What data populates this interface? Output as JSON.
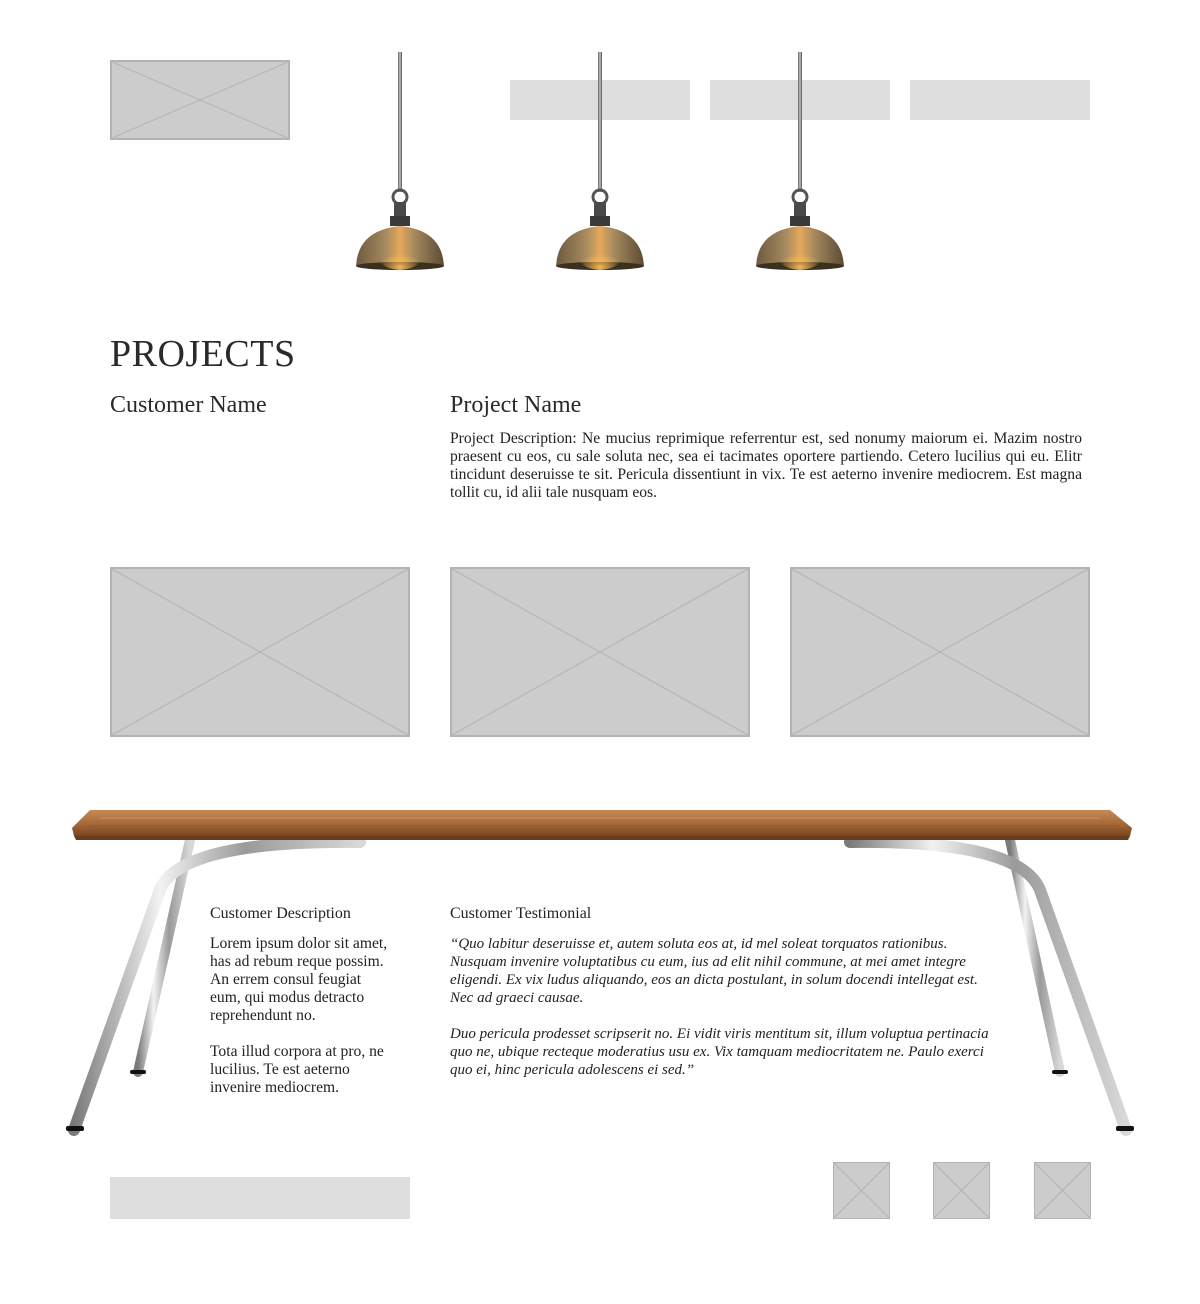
{
  "header": {
    "logo_placeholder": "logo-image-placeholder",
    "nav_items": [
      "",
      "",
      ""
    ]
  },
  "projects": {
    "heading": "PROJECTS",
    "customer_name": "Customer Name",
    "project_name": "Project Name",
    "project_description": "Project Description: Ne mucius reprimique referrentur est, sed nonumy maiorum ei. Mazim nostro praesent cu eos, cu sale soluta nec, sea ei tacimates oportere partiendo. Cetero lucilius qui eu. Elitr tincidunt deseruisse te sit. Pericula dissentiunt in vix. Te est aeterno invenire me­diocrem. Est magna tollit cu, id alii tale nusquam eos."
  },
  "customer": {
    "description_title": "Customer Description",
    "description_paragraphs": [
      "Lorem ipsum dolor sit amet, has ad rebum reque possim. An errem consul feugiat eum, qui modus detracto reprehendunt no.",
      "Tota illud corpora at pro, ne lucilius. Te est aeterno invenire mediocrem."
    ],
    "testimonial_title": "Customer Testimonial",
    "testimonial_paragraphs": [
      "“Quo labitur deseruisse et, autem soluta eos at, id mel soleat torquatos rationibus. Nusquam invenire voluptatibus cu eum, ius ad elit nihil commune, at mei amet integre eligendi. Ex vix ludus aliquando, eos an dicta postulant, in solum docendi intellegat est. Nec ad graeci causae.",
      "Duo pericula prodesset scripserit no. Ei vidit viris mentitum sit, illum voluptua pertinacia quo ne, ubique recteque moderatius usu ex. Vix tamquam mediocritatem ne. Paulo exerci quo ei, hinc pericula adolescens ei sed.”"
    ]
  },
  "colors": {
    "placeholder_fill": "#cccccc",
    "placeholder_border": "#b3b3b3",
    "bar_fill": "#dedede",
    "text": "#222222",
    "wood": "#a86a3a"
  },
  "icons": [
    "pendant-lamp-image",
    "table-image",
    "image-placeholder-icon"
  ]
}
